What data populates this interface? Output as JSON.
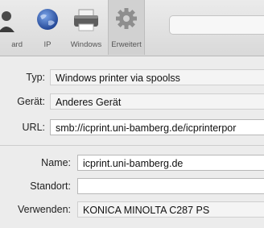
{
  "toolbar": {
    "items": [
      {
        "label": "ard",
        "icon": "user-accounts-icon"
      },
      {
        "label": "IP",
        "icon": "globe-icon"
      },
      {
        "label": "Windows",
        "icon": "printer-icon"
      },
      {
        "label": "Erweitert",
        "icon": "gear-icon"
      }
    ],
    "selected": "Erweitert"
  },
  "form": {
    "typ_label": "Typ:",
    "typ_value": "Windows printer via spoolss",
    "geraet_label": "Gerät:",
    "geraet_value": "Anderes Gerät",
    "url_label": "URL:",
    "url_value": "smb://icprint.uni-bamberg.de/icprinterpor",
    "name_label": "Name:",
    "name_value": "icprint.uni-bamberg.de",
    "standort_label": "Standort:",
    "standort_value": "",
    "verwenden_label": "Verwenden:",
    "verwenden_value": "KONICA MINOLTA C287 PS"
  },
  "colors": {
    "toolbar_bg": "#dedede",
    "window_bg": "#ececec",
    "field_bg": "#f4f4f4"
  }
}
